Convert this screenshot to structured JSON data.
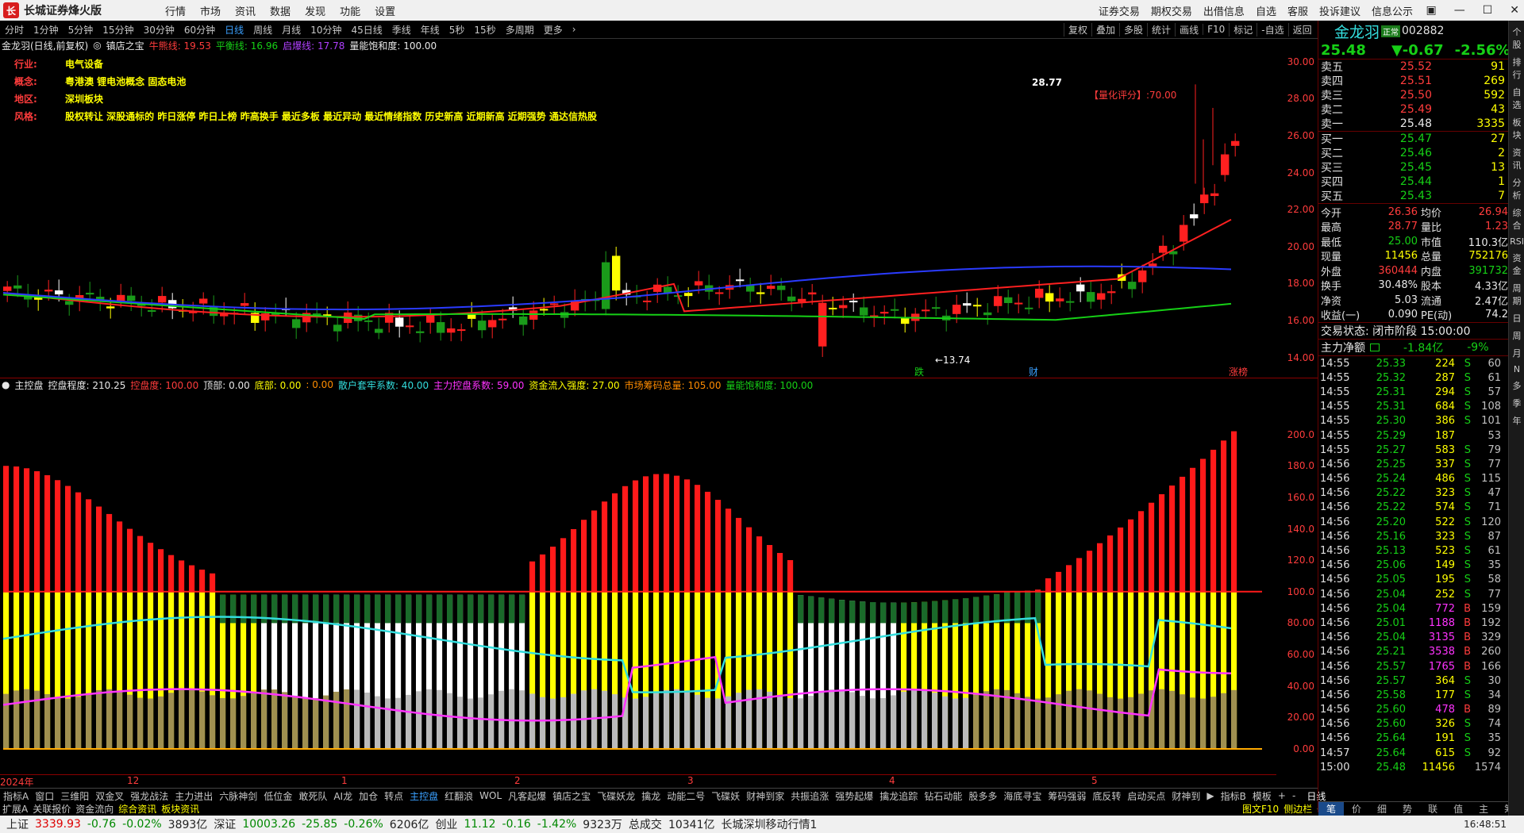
{
  "window": {
    "title": "长城证券烽火版",
    "menus": [
      "行情",
      "市场",
      "资讯",
      "数据",
      "发现",
      "功能",
      "设置"
    ],
    "right_menus": [
      "证券交易",
      "期权交易",
      "出借信息",
      "自选",
      "客服",
      "投诉建议",
      "信息公示"
    ]
  },
  "periods": [
    "分时",
    "1分钟",
    "5分钟",
    "15分钟",
    "30分钟",
    "60分钟",
    "日线",
    "周线",
    "月线",
    "10分钟",
    "45日线",
    "季线",
    "年线",
    "5秒",
    "15秒",
    "多周期",
    "更多"
  ],
  "active_period": "日线",
  "right_tools": [
    "复权",
    "叠加",
    "多股",
    "统计",
    "画线",
    "F10",
    "标记",
    "-自选",
    "返回"
  ],
  "main_legend": {
    "name": "金龙羽(日线,前复权)",
    "indicator": "镇店之宝",
    "items": [
      {
        "label": "牛熊线: 19.53",
        "color": "#ff3c3c"
      },
      {
        "label": "平衡线: 16.96",
        "color": "#16d016"
      },
      {
        "label": "启爆线: 17.78",
        "color": "#b040ff"
      },
      {
        "label": "量能饱和度: 100.00",
        "color": "#e8e8e8"
      }
    ]
  },
  "info": [
    {
      "k": "行业:",
      "v": "电气设备"
    },
    {
      "k": "概念:",
      "v": "粤港澳 锂电池概念 固态电池"
    },
    {
      "k": "地区:",
      "v": "深圳板块"
    },
    {
      "k": "风格:",
      "v": "股权转让 深股通标的 昨日涨停 昨日上榜 昨高换手 最近多板 最近异动 最近情绪指数 历史新高 近期新高 近期强势 通达信热股"
    }
  ],
  "score_label": "【量化评分】:70.00",
  "price_axis": [
    "30.00",
    "28.00",
    "26.00",
    "24.00",
    "22.00",
    "20.00",
    "18.00",
    "16.00",
    "14.00"
  ],
  "hi_label": "28.77",
  "lo_label": "13.74",
  "sub_legend": {
    "name": "主控盘",
    "items": [
      {
        "label": "控盘程度: 210.25",
        "color": "#e8e8e8"
      },
      {
        "label": "控盘度: 100.00",
        "color": "#ff3c3c"
      },
      {
        "label": "顶部: 0.00",
        "color": "#e8e8e8"
      },
      {
        "label": "底部: 0.00",
        "color": "#ffff00"
      },
      {
        "label": ": 0.00",
        "color": "#ff8c00"
      },
      {
        "label": "散户套牢系数: 40.00",
        "color": "#33dddd"
      },
      {
        "label": "主力控盘系数: 59.00",
        "color": "#ff33ff"
      },
      {
        "label": "资金流入强度: 27.00",
        "color": "#ffff00"
      },
      {
        "label": "市场筹码总量: 105.00",
        "color": "#ff8c00"
      },
      {
        "label": "量能饱和度: 100.00",
        "color": "#16d016"
      }
    ]
  },
  "sub_axis": [
    "200.0",
    "180.0",
    "160.0",
    "140.0",
    "120.0",
    "100.0",
    "80.00",
    "60.00",
    "40.00",
    "20.00",
    "0.00"
  ],
  "date_axis": [
    {
      "label": "2024年",
      "pos": 0
    },
    {
      "label": "12",
      "pos": 160
    },
    {
      "label": "1",
      "pos": 430
    },
    {
      "label": "2",
      "pos": 648
    },
    {
      "label": "3",
      "pos": 866
    },
    {
      "label": "4",
      "pos": 1120
    },
    {
      "label": "5",
      "pos": 1375
    }
  ],
  "event_marks": [
    {
      "label": "跌",
      "pos": 1152,
      "color": "#16d016"
    },
    {
      "label": "财",
      "pos": 1296,
      "color": "#3aa0ff"
    },
    {
      "label": "涨榜",
      "pos": 1548,
      "color": "#ff3c3c"
    }
  ],
  "stock": {
    "name": "金龙羽",
    "tag": "正常",
    "code": "002882",
    "price": "25.48",
    "change": "▼-0.67",
    "pct": "-2.56%"
  },
  "asks": [
    {
      "l": "卖五",
      "p": "25.52",
      "v": "91"
    },
    {
      "l": "卖四",
      "p": "25.51",
      "v": "269"
    },
    {
      "l": "卖三",
      "p": "25.50",
      "v": "592"
    },
    {
      "l": "卖二",
      "p": "25.49",
      "v": "43"
    },
    {
      "l": "卖一",
      "p": "25.48",
      "v": "3335"
    }
  ],
  "bids": [
    {
      "l": "买一",
      "p": "25.47",
      "v": "27"
    },
    {
      "l": "买二",
      "p": "25.46",
      "v": "2"
    },
    {
      "l": "买三",
      "p": "25.45",
      "v": "13"
    },
    {
      "l": "买四",
      "p": "25.44",
      "v": "1"
    },
    {
      "l": "买五",
      "p": "25.43",
      "v": "7"
    }
  ],
  "quote": [
    {
      "a": "今开",
      "av": "26.36",
      "ac": "red",
      "b": "均价",
      "bv": "26.94",
      "bc": "red"
    },
    {
      "a": "最高",
      "av": "28.77",
      "ac": "red",
      "b": "量比",
      "bv": "1.23",
      "bc": "red"
    },
    {
      "a": "最低",
      "av": "25.00",
      "ac": "green",
      "b": "市值",
      "bv": "110.3亿",
      "bc": "white"
    },
    {
      "a": "现量",
      "av": "11456",
      "ac": "yellow",
      "b": "总量",
      "bv": "752176",
      "bc": "yellow"
    },
    {
      "a": "外盘",
      "av": "360444",
      "ac": "red",
      "b": "内盘",
      "bv": "391732",
      "bc": "green"
    },
    {
      "a": "换手",
      "av": "30.48%",
      "ac": "white",
      "b": "股本",
      "bv": "4.33亿",
      "bc": "white"
    },
    {
      "a": "净资",
      "av": "5.03",
      "ac": "white",
      "b": "流通",
      "bv": "2.47亿",
      "bc": "white"
    },
    {
      "a": "收益(一)",
      "av": "0.090",
      "ac": "white",
      "b": "PE(动)",
      "bv": "74.2",
      "bc": "white"
    }
  ],
  "trade_state": "交易状态: 闭市阶段 15:00:00",
  "net_flow": {
    "label": "主力净额",
    "value": "-1.84亿",
    "pct": "-9%"
  },
  "ticks": [
    [
      "14:55",
      "25.33",
      "224",
      "S",
      "60"
    ],
    [
      "14:55",
      "25.32",
      "287",
      "S",
      "61"
    ],
    [
      "14:55",
      "25.31",
      "294",
      "S",
      "57"
    ],
    [
      "14:55",
      "25.31",
      "684",
      "S",
      "108"
    ],
    [
      "14:55",
      "25.30",
      "386",
      "S",
      "101"
    ],
    [
      "14:55",
      "25.29",
      "187",
      "",
      "53"
    ],
    [
      "14:55",
      "25.27",
      "583",
      "S",
      "79"
    ],
    [
      "14:56",
      "25.25",
      "337",
      "S",
      "77"
    ],
    [
      "14:56",
      "25.24",
      "486",
      "S",
      "115"
    ],
    [
      "14:56",
      "25.22",
      "323",
      "S",
      "47"
    ],
    [
      "14:56",
      "25.22",
      "574",
      "S",
      "71"
    ],
    [
      "14:56",
      "25.20",
      "522",
      "S",
      "120"
    ],
    [
      "14:56",
      "25.16",
      "323",
      "S",
      "87"
    ],
    [
      "14:56",
      "25.13",
      "523",
      "S",
      "61"
    ],
    [
      "14:56",
      "25.06",
      "149",
      "S",
      "35"
    ],
    [
      "14:56",
      "25.05",
      "195",
      "S",
      "58"
    ],
    [
      "14:56",
      "25.04",
      "252",
      "S",
      "77"
    ],
    [
      "14:56",
      "25.04",
      "772",
      "B",
      "159"
    ],
    [
      "14:56",
      "25.01",
      "1188",
      "B",
      "192"
    ],
    [
      "14:56",
      "25.04",
      "3135",
      "B",
      "329"
    ],
    [
      "14:56",
      "25.21",
      "3538",
      "B",
      "260"
    ],
    [
      "14:56",
      "25.57",
      "1765",
      "B",
      "166"
    ],
    [
      "14:56",
      "25.57",
      "364",
      "S",
      "30"
    ],
    [
      "14:56",
      "25.58",
      "177",
      "S",
      "34"
    ],
    [
      "14:56",
      "25.60",
      "478",
      "B",
      "89"
    ],
    [
      "14:56",
      "25.60",
      "326",
      "S",
      "74"
    ],
    [
      "14:56",
      "25.64",
      "191",
      "S",
      "35"
    ],
    [
      "14:57",
      "25.64",
      "615",
      "S",
      "92"
    ],
    [
      "15:00",
      "25.48",
      "11456",
      "",
      "1574"
    ]
  ],
  "bottom_tabs": [
    "笔",
    "价",
    "细",
    "势",
    "联",
    "值",
    "主",
    "筹"
  ],
  "indicators": [
    "指标A",
    "窗口",
    "三维阳",
    "双金叉",
    "强龙战法",
    "主力进出",
    "六脉神剑",
    "低位金",
    "敢死队",
    "AI龙",
    "加仓",
    "转点",
    "主控盘",
    "红翻浪",
    "WOL",
    "凡客起爆",
    "镇店之宝",
    "飞碟妖龙",
    "擒龙",
    "动能二号",
    "飞碟妖",
    "财神到家",
    "共振追涨",
    "强势起爆",
    "擒龙追踪",
    "钻石动能",
    "股多多",
    "海底寻宝",
    "筹码强弱",
    "底反转",
    "启动买点",
    "财神到"
  ],
  "active_indicator": "主控盘",
  "ind_right": [
    "指标B",
    "模板",
    "+",
    "-"
  ],
  "day_label": "日线",
  "sub_tabs": [
    "扩展A",
    "关联报价",
    "资金流向",
    "综合资讯",
    "板块资讯"
  ],
  "sub_right": [
    "图文F10",
    "侧边栏《"
  ],
  "status": [
    {
      "t": "上证",
      "c": "#222"
    },
    {
      "t": "3339.93",
      "c": "#d00"
    },
    {
      "t": "-0.76",
      "c": "#080"
    },
    {
      "t": "-0.02%",
      "c": "#080"
    },
    {
      "t": "3893亿",
      "c": "#222"
    },
    {
      "t": "深证",
      "c": "#222"
    },
    {
      "t": "10003.26",
      "c": "#080"
    },
    {
      "t": "-25.85",
      "c": "#080"
    },
    {
      "t": "-0.26%",
      "c": "#080"
    },
    {
      "t": "6206亿",
      "c": "#222"
    },
    {
      "t": "创业",
      "c": "#222"
    },
    {
      "t": "11.12",
      "c": "#080"
    },
    {
      "t": "-0.16",
      "c": "#080"
    },
    {
      "t": "-1.42%",
      "c": "#080"
    },
    {
      "t": "9323万",
      "c": "#222"
    },
    {
      "t": "总成交",
      "c": "#222"
    },
    {
      "t": "10341亿",
      "c": "#222"
    },
    {
      "t": "长城深圳移动行情1",
      "c": "#222"
    }
  ],
  "clock": "16:48:51",
  "side_icons": [
    "个股",
    "排行",
    "自选",
    "板块",
    "资讯",
    "分析",
    "综合",
    "RSI",
    "资金",
    "周期",
    "日",
    "周",
    "月",
    "N",
    "多",
    "季",
    "年"
  ],
  "chart_data": {
    "type": "candlestick",
    "ylim_price": [
      13,
      30.5
    ],
    "ylim_sub": [
      0,
      210
    ],
    "bars": 120,
    "close_last": 25.48,
    "high": 28.77,
    "low": 13.74
  }
}
